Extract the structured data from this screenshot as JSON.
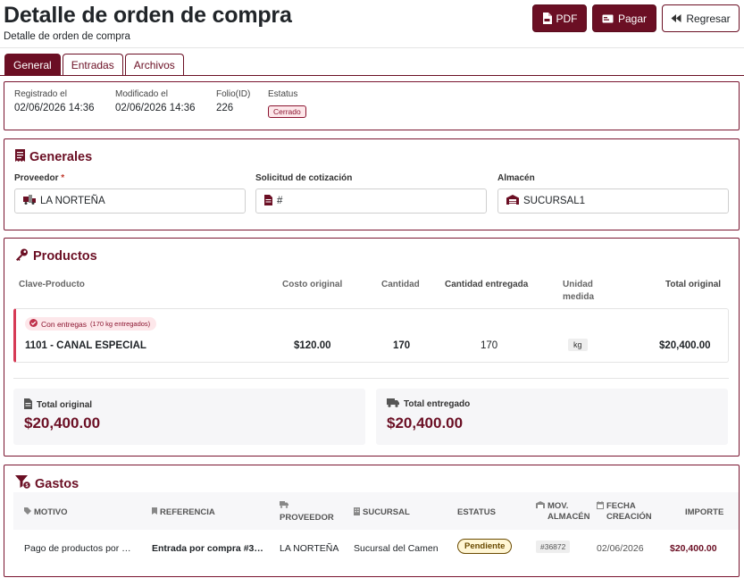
{
  "header": {
    "title": "Detalle de orden de compra",
    "subtitle": "Detalle de orden de compra",
    "buttons": {
      "pdf": "PDF",
      "pay": "Pagar",
      "back": "Regresar"
    }
  },
  "tabs": [
    {
      "label": "General",
      "active": true
    },
    {
      "label": "Entradas",
      "active": false
    },
    {
      "label": "Archivos",
      "active": false
    }
  ],
  "meta": {
    "registered_label": "Registrado el",
    "registered_value": "02/06/2026 14:36",
    "modified_label": "Modificado el",
    "modified_value": "02/06/2026 14:36",
    "folio_label": "Folio(ID)",
    "folio_value": "226",
    "status_label": "Estatus",
    "status_value": "Cerrado"
  },
  "generales": {
    "title": "Generales",
    "proveedor_label": "Proveedor",
    "proveedor_required": "*",
    "proveedor_value": "LA NORTEÑA",
    "solicitud_label": "Solicitud de cotización",
    "solicitud_value": "#",
    "almacen_label": "Almacén",
    "almacen_value": "SUCURSAL1"
  },
  "productos": {
    "title": "Productos",
    "columns": {
      "clave": "Clave-Producto",
      "costo": "Costo original",
      "cantidad": "Cantidad",
      "entregada": "Cantidad entregada",
      "unidad": "Unidad medida",
      "total": "Total original"
    },
    "rows": [
      {
        "badge": "Con entregas",
        "badge_detail": "(170 kg entregados)",
        "name": "1101 - CANAL ESPECIAL",
        "costo": "$120.00",
        "cantidad": "170",
        "entregada": "170",
        "unidad": "kg",
        "total": "$20,400.00"
      }
    ],
    "total_original_label": "Total original",
    "total_original_value": "$20,400.00",
    "total_entregado_label": "Total entregado",
    "total_entregado_value": "$20,400.00"
  },
  "gastos": {
    "title": "Gastos",
    "columns": {
      "motivo": "MOTIVO",
      "referencia": "REFERENCIA",
      "proveedor": "PROVEEDOR",
      "sucursal": "SUCURSAL",
      "estatus": "ESTATUS",
      "mov_almacen": "MOV. ALMACÉN",
      "fecha": "FECHA CREACIÓN",
      "importe": "IMPORTE"
    },
    "rows": [
      {
        "motivo": "Pago de productos por …",
        "referencia": "Entrada por compra #3…",
        "proveedor": "LA NORTEÑA",
        "sucursal": "Sucursal del Camen",
        "estatus": "Pendiente",
        "mov_almacen": "#36872",
        "fecha": "02/06/2026",
        "importe": "$20,400.00"
      }
    ]
  },
  "colors": {
    "accent": "#6b0f24",
    "danger_soft": "#fde7ea",
    "warning_soft": "#fff6d5"
  }
}
